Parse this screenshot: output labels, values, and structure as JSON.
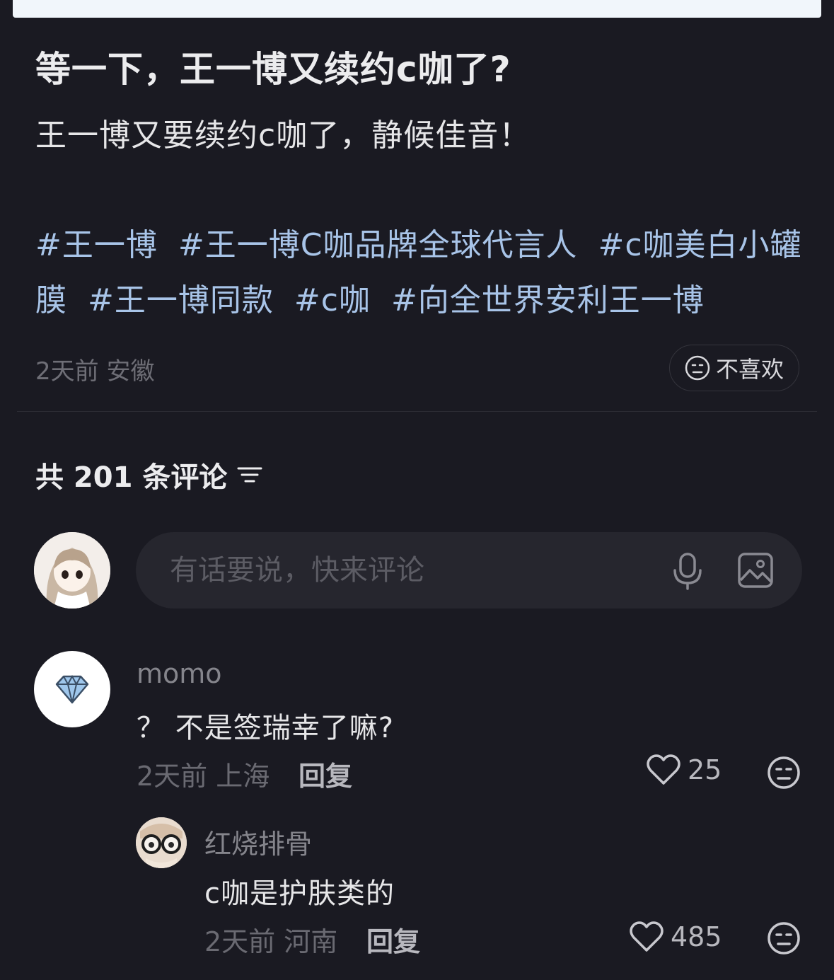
{
  "post": {
    "title": "等一下，王一博又续约c咖了?",
    "body": "王一博又要续约c咖了，静候佳音！",
    "tags": [
      "#王一博",
      "#王一博C咖品牌全球代言人",
      "#c咖美白小罐膜",
      "#王一博同款",
      "#c咖",
      "#向全世界安利王一博"
    ],
    "meta": "2天前 安徽",
    "dislike_label": "不喜欢"
  },
  "comments_header": {
    "label": "共 201 条评论"
  },
  "input": {
    "placeholder": "有话要说，快来评论"
  },
  "comments": [
    {
      "user": "momo",
      "text": "？ 不是签瑞幸了嘛?",
      "meta": "2天前 上海",
      "reply_label": "回复",
      "likes": "25"
    },
    {
      "user": "红烧排骨",
      "text": "c咖是护肤类的",
      "meta": "2天前 河南",
      "reply_label": "回复",
      "likes": "485"
    }
  ],
  "colors": {
    "background": "#1a1a22",
    "tag": "#a8c4e8",
    "input_bg": "#26262e"
  }
}
